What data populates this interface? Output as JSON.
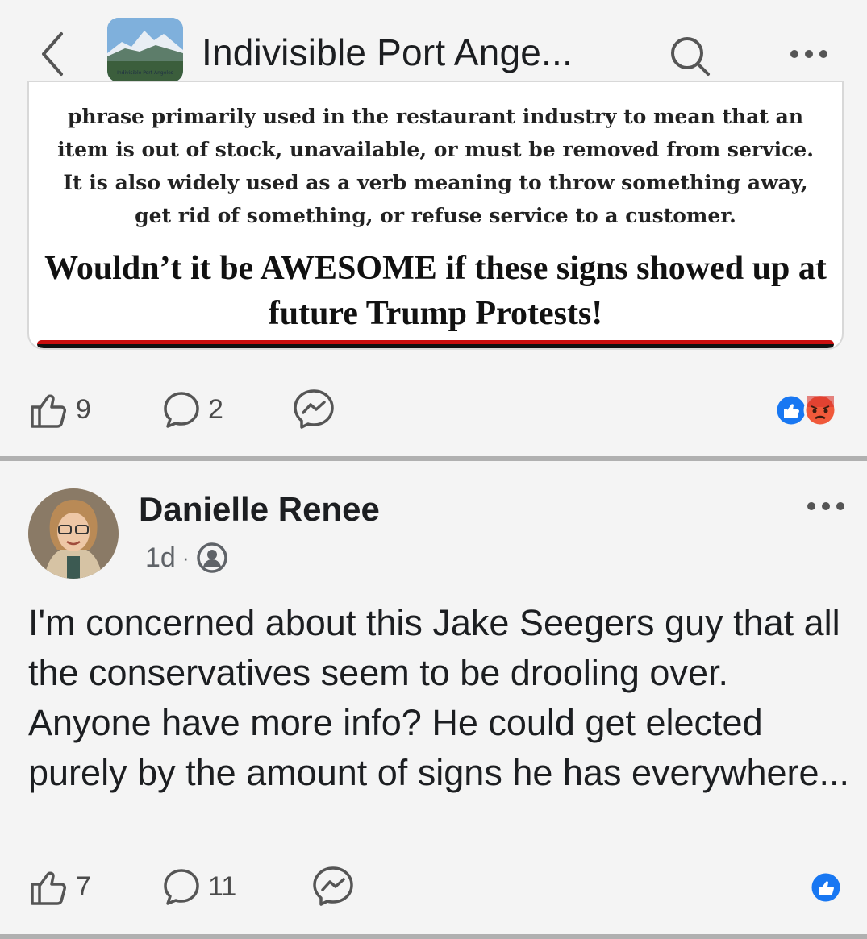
{
  "header": {
    "group_name": "Indivisible Port Ange...",
    "icon_label": "Indivisible Port Angeles"
  },
  "shared_post": {
    "body_text": "phrase primarily used in the restaurant industry to mean that an item is out of stock, unavailable, or must be removed from service. It is also widely used as a verb meaning to throw something away, get rid of something, or refuse service to a customer.",
    "cta_text": "Wouldn’t it be AWESOME if these signs showed up at future Trump Protests!",
    "likes": "9",
    "comments": "2",
    "reactions": [
      "like",
      "angry"
    ]
  },
  "post": {
    "author": "Danielle Renee",
    "time": "1d",
    "separator": "·",
    "audience_icon": "members-icon",
    "text": "I'm concerned about this Jake Seegers guy that all the conservatives seem to be drooling over. Anyone have more info? He could get elected purely by the amount of signs he has everywhere...",
    "likes": "7",
    "comments": "11",
    "reactions": [
      "like"
    ]
  },
  "colors": {
    "like_blue": "#1877f2",
    "angry_orange": "#f0593a",
    "band_red": "#c90e0e",
    "icon_gray": "#606770"
  }
}
